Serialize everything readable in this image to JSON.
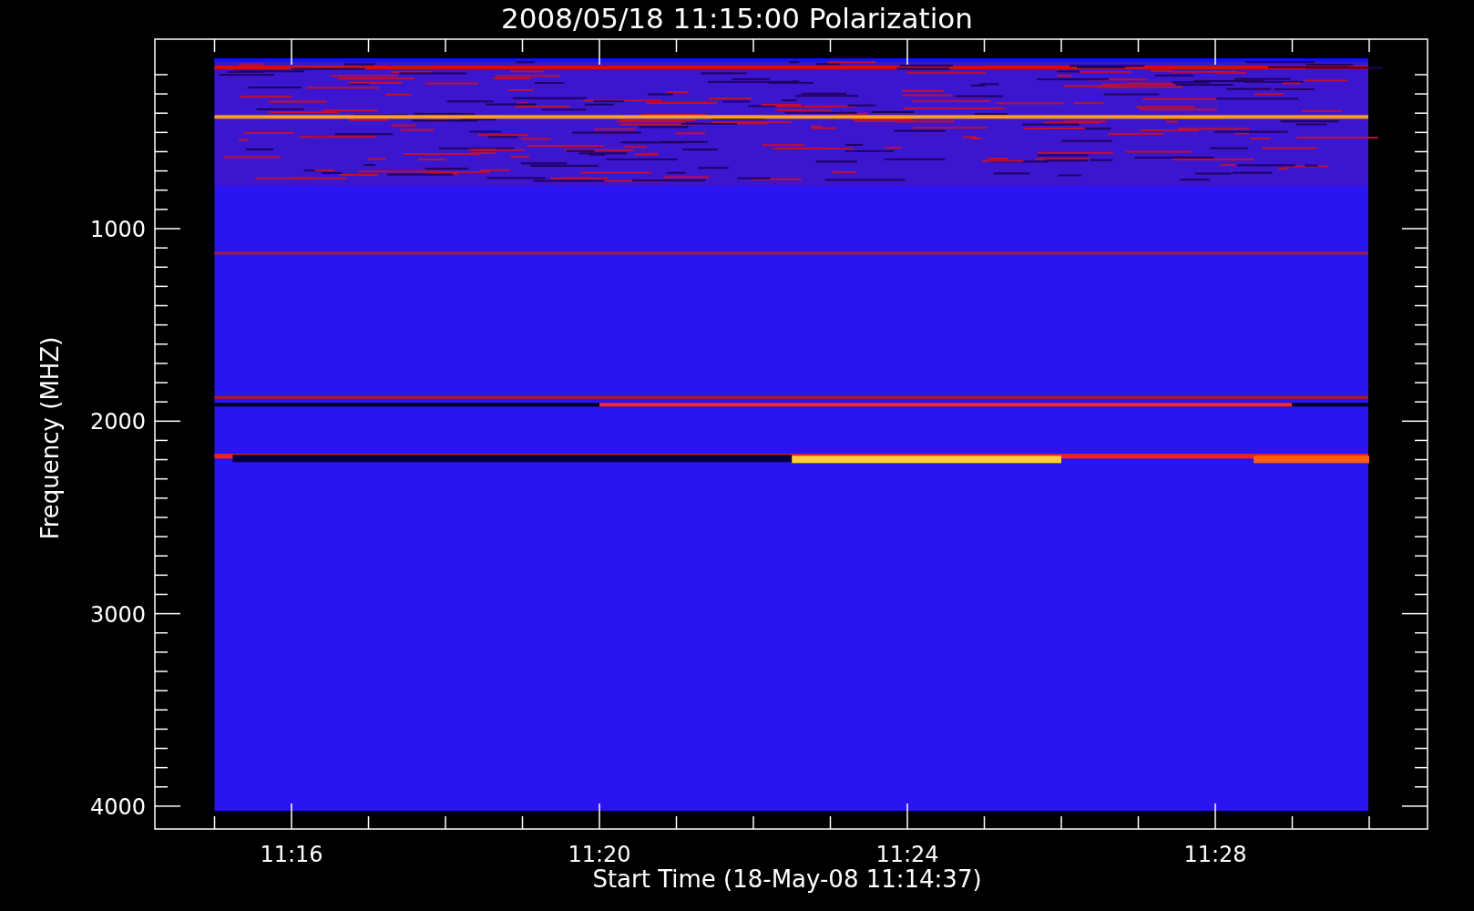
{
  "title": "2008/05/18 11:15:00 Polarization",
  "y_axis": {
    "label": "Frequency (MHZ)",
    "ticks": [
      "1000",
      "2000",
      "3000",
      "4000"
    ]
  },
  "x_axis": {
    "label": "Start Time (18-May-08 11:14:37)",
    "ticks": [
      "11:16",
      "11:20",
      "11:24",
      "11:28"
    ]
  }
}
